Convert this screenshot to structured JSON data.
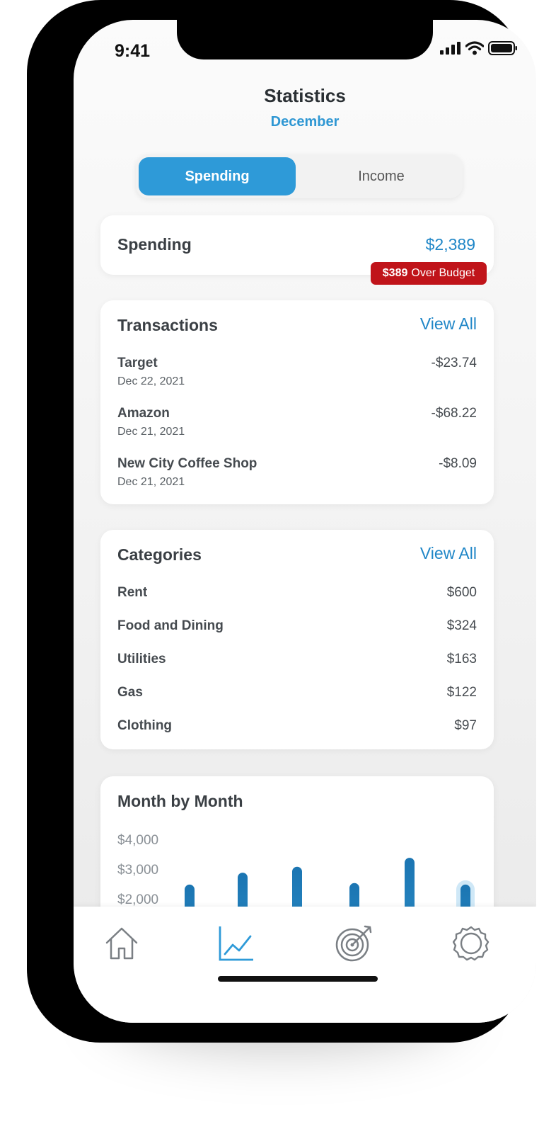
{
  "status": {
    "time": "9:41"
  },
  "header": {
    "title": "Statistics",
    "month": "December"
  },
  "segment": {
    "spending": "Spending",
    "income": "Income",
    "selected": "Spending"
  },
  "spending": {
    "label": "Spending",
    "amount": "$2,389",
    "over_amount": "$389",
    "over_text": "Over Budget"
  },
  "transactions": {
    "title": "Transactions",
    "view_all": "View All",
    "items": [
      {
        "name": "Target",
        "date": "Dec 22, 2021",
        "amount": "-$23.74"
      },
      {
        "name": "Amazon",
        "date": "Dec 21, 2021",
        "amount": "-$68.22"
      },
      {
        "name": "New City Coffee Shop",
        "date": "Dec 21, 2021",
        "amount": "-$8.09"
      }
    ]
  },
  "categories": {
    "title": "Categories",
    "view_all": "View All",
    "items": [
      {
        "name": "Rent",
        "amount": "$600"
      },
      {
        "name": "Food and Dining",
        "amount": "$324"
      },
      {
        "name": "Utilities",
        "amount": "$163"
      },
      {
        "name": "Gas",
        "amount": "$122"
      },
      {
        "name": "Clothing",
        "amount": "$97"
      }
    ]
  },
  "month_by_month": {
    "title": "Month by Month",
    "y_labels": [
      "$4,000",
      "$3,000",
      "$2,000"
    ],
    "bar_values": [
      2550,
      2950,
      3150,
      2600,
      3450,
      2550
    ],
    "highlight_index": 5,
    "bar_color": "#2180c0"
  },
  "tabbar": {
    "items": [
      "home-icon",
      "chart-icon",
      "target-icon",
      "gear-icon"
    ],
    "active": "chart-icon"
  },
  "colors": {
    "accent": "#2e9ad8",
    "link": "#1f86c7",
    "danger": "#c0141a"
  }
}
